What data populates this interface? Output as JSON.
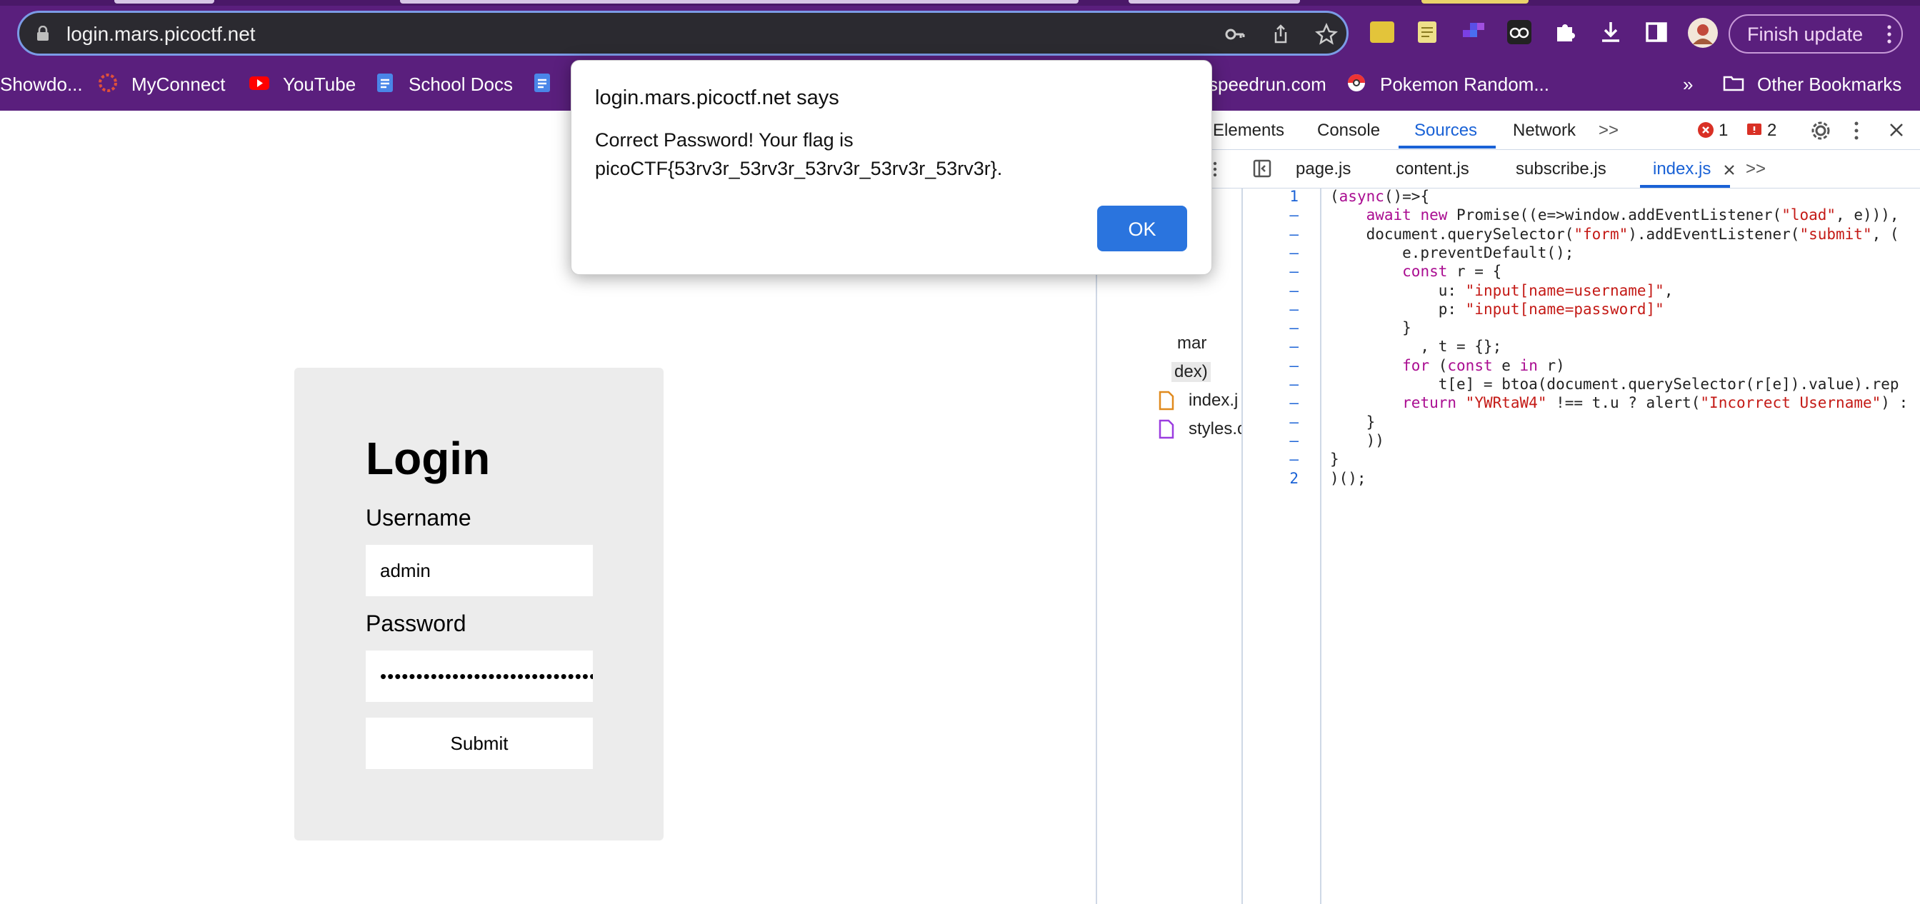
{
  "browser": {
    "url": "login.mars.picoctf.net",
    "finish_update_label": "Finish update",
    "bookmarks": [
      {
        "label": "Showdo..."
      },
      {
        "label": "MyConnect"
      },
      {
        "label": "YouTube"
      },
      {
        "label": "School Docs"
      },
      {
        "label": "speedrun.com"
      },
      {
        "label": "Pokemon Random..."
      },
      {
        "label": "»"
      },
      {
        "label": "Other Bookmarks"
      }
    ]
  },
  "login": {
    "title": "Login",
    "username_label": "Username",
    "username_value": "admin",
    "password_label": "Password",
    "password_value": "••••••••••••••••••••••••••••••",
    "submit_label": "Submit"
  },
  "dialog": {
    "title": "login.mars.picoctf.net says",
    "message_line1": "Correct Password! Your flag is",
    "message_line2": "picoCTF{53rv3r_53rv3r_53rv3r_53rv3r_53rv3r}.",
    "ok_label": "OK"
  },
  "devtools": {
    "tabs": [
      "Elements",
      "Console",
      "Sources",
      "Network",
      ">>"
    ],
    "active_tab": "Sources",
    "error_count": "1",
    "warning_count": "2",
    "file_tabs": [
      "page.js",
      "content.js",
      "subscribe.js",
      "index.js"
    ],
    "active_file": "index.js",
    "navigator_items": [
      "mar",
      "dex)",
      "index.j",
      "styles.c"
    ],
    "line_numbers": [
      "1",
      "–",
      "–",
      "–",
      "–",
      "–",
      "–",
      "–",
      "–",
      "–",
      "–",
      "–",
      "–",
      "–",
      "–",
      "2"
    ],
    "code_lines": [
      "(async()=>{",
      "    await new Promise((e=>window.addEventListener(\"load\", e))),",
      "    document.querySelector(\"form\").addEventListener(\"submit\", (",
      "        e.preventDefault();",
      "        const r = {",
      "            u: \"input[name=username]\",",
      "            p: \"input[name=password]\"",
      "        }",
      "          , t = {};",
      "        for (const e in r)",
      "            t[e] = btoa(document.querySelector(r[e]).value).rep",
      "        return \"YWRtaW4\" !== t.u ? alert(\"Incorrect Username\") :",
      "    }",
      "    ))",
      "}",
      ")();"
    ]
  },
  "colors": {
    "chrome_bg": "#5a1f7d",
    "accent_blue": "#1a62d6",
    "ok_button": "#2a74de",
    "login_card": "#ececec"
  }
}
